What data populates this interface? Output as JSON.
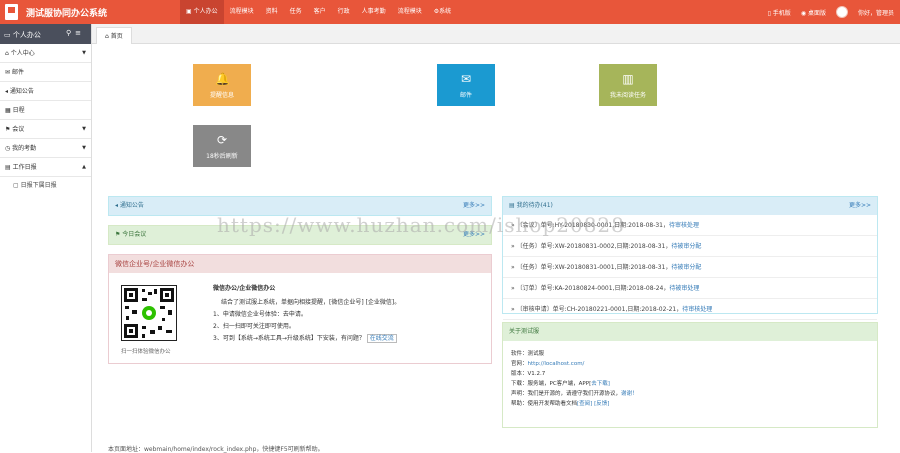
{
  "header": {
    "app_title": "测试服协同办公系统",
    "nav": [
      "个人办公",
      "流程模块",
      "资料",
      "任务",
      "客户",
      "行政",
      "人事考勤",
      "流程模块",
      "系统"
    ],
    "mobile": "手机版",
    "desktop": "桌面版",
    "greeting": "你好，管理员"
  },
  "sidebar": {
    "title": "个人办公",
    "items": [
      {
        "label": "个人中心",
        "caret": "▼"
      },
      {
        "label": "邮件"
      },
      {
        "label": "通知公告"
      },
      {
        "label": "日程"
      },
      {
        "label": "会议",
        "caret": "▼"
      },
      {
        "label": "我的考勤",
        "caret": "▼"
      },
      {
        "label": "工作日报",
        "caret": "▲"
      }
    ],
    "subitem": "日报下属日报"
  },
  "tabs": {
    "home": "首页"
  },
  "tiles": [
    {
      "label": "提醒信息",
      "icon": "bell-icon",
      "color": "#f0ad4e"
    },
    {
      "label": "邮件",
      "icon": "envelope-icon",
      "color": "#1b9ad1"
    },
    {
      "label": "我未阅读任务",
      "icon": "book-icon",
      "color": "#a6b55a"
    },
    {
      "label": "18秒后刷新",
      "icon": "refresh-icon",
      "color": "#888888"
    }
  ],
  "notice_panel": {
    "title": "通知公告",
    "more": "更多>>"
  },
  "meeting_panel": {
    "title": "今日会议",
    "more": "更多>>"
  },
  "wechat_panel": {
    "title": "微信企业号/企业微信办公",
    "heading": "微信办公/企业微信办公",
    "line1": "结合了测试服上系统，单据向相接提醒，[微信企业号] [企业微信]。",
    "line2": "1、申请微信企业号体验：去申请。",
    "line3": "2、扫一扫即可关注即可使用。",
    "line4": "3、可到【系统→系统工具→升级系统】下安装，有问题？",
    "online": "在线交流",
    "qr_caption": "扫一扫体验微信办公"
  },
  "todo_panel": {
    "title": "我的待办(41)",
    "more": "更多>>",
    "rows": [
      {
        "text": "〔会议〕单号:HY-20180830-0001,日期:2018-08-31，",
        "status": "待审核处理"
      },
      {
        "text": "〔任务〕单号:XW-20180831-0002,日期:2018-08-31，",
        "status": "待被审分配"
      },
      {
        "text": "〔任务〕单号:XW-20180831-0001,日期:2018-08-31，",
        "status": "待被审分配"
      },
      {
        "text": "〔订单〕单号:KA-20180824-0001,日期:2018-08-24，",
        "status": "待被审处理"
      },
      {
        "text": "〔审核申请〕单号:CH-20180221-0001,日期:2018-02-21，",
        "status": "待审核处理"
      }
    ]
  },
  "about_panel": {
    "title": "关于测试服",
    "rows": [
      {
        "k": "软件：",
        "v": "测试服",
        "link": ""
      },
      {
        "k": "官网：",
        "v": "",
        "link": "http://localhost.com/"
      },
      {
        "k": "版本：",
        "v": "V1.2.7",
        "link": ""
      },
      {
        "k": "下载：",
        "v": "服务端，PC客户端，APP[",
        "link": "去下载]"
      },
      {
        "k": "声明：",
        "v": "我们是开源的，请遵守我们开源协议，",
        "link": "谢谢！"
      },
      {
        "k": "帮助：",
        "v": "使用开发帮助看文档",
        "link": "[查阅] [反馈]"
      }
    ]
  },
  "footer": "本页面地址：webmain/home/index/rock_index.php，快捷键F5可刷新帮助。",
  "watermark": "https://www.huzhan.com/ishop20828"
}
